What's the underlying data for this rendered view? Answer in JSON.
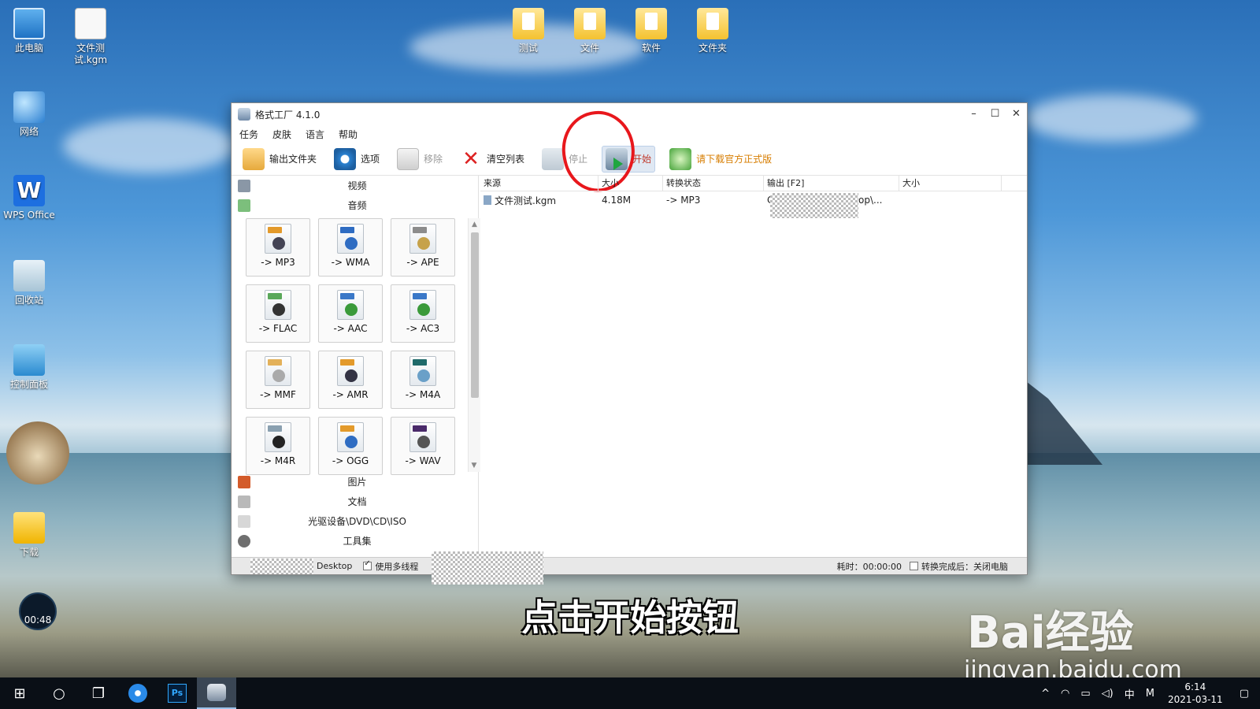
{
  "desktop": {
    "icons": [
      {
        "label": "此电脑"
      },
      {
        "label": "文件测试.kgm"
      },
      {
        "label": "网络"
      },
      {
        "label": "WPS Office"
      },
      {
        "label": "回收站"
      },
      {
        "label": "控制面板"
      },
      {
        "label": "下载"
      },
      {
        "label": "测试"
      },
      {
        "label": "文件"
      },
      {
        "label": "软件"
      },
      {
        "label": "文件夹"
      }
    ],
    "timer": "00:48"
  },
  "window": {
    "title": "格式工厂 4.1.0",
    "controls": {
      "minimize": "–",
      "maximize": "☐",
      "close": "✕"
    },
    "menu": [
      "任务",
      "皮肤",
      "语言",
      "帮助"
    ],
    "toolbar": {
      "output_folder": "输出文件夹",
      "options": "选项",
      "remove": "移除",
      "clear_list": "清空列表",
      "stop": "停止",
      "start": "开始",
      "download_official": "请下载官方正式版"
    },
    "categories_top": [
      "视频",
      "音频"
    ],
    "formats": [
      {
        "label": "-> MP3"
      },
      {
        "label": "-> WMA"
      },
      {
        "label": "-> APE"
      },
      {
        "label": "-> FLAC"
      },
      {
        "label": "-> AAC"
      },
      {
        "label": "-> AC3"
      },
      {
        "label": "-> MMF"
      },
      {
        "label": "-> AMR"
      },
      {
        "label": "-> M4A"
      },
      {
        "label": "-> M4R"
      },
      {
        "label": "-> OGG"
      },
      {
        "label": "-> WAV"
      }
    ],
    "categories_bottom": [
      "图片",
      "文档",
      "光驱设备\\DVD\\CD\\ISO",
      "工具集"
    ],
    "list": {
      "columns": [
        "来源",
        "大小",
        "转换状态",
        "输出 [F2]",
        "大小"
      ],
      "rows": [
        {
          "source": "文件测试.kgm",
          "size": "4.18M",
          "status": "-> MP3",
          "output_start": "C",
          "output_end": "op\\..."
        }
      ]
    },
    "status": {
      "folder": "Desktop",
      "multithread": "使用多线程",
      "elapsed": "耗时：00:00:00",
      "after_done": "转换完成后：关闭电脑"
    }
  },
  "caption": "点击开始按钮",
  "watermark": {
    "brand": "Bai经验",
    "url": "jingyan.baidu.com"
  },
  "taskbar": {
    "tray": {
      "ime": "中",
      "ime2": "M",
      "time": "6:14",
      "date": "2021-03-11"
    }
  }
}
